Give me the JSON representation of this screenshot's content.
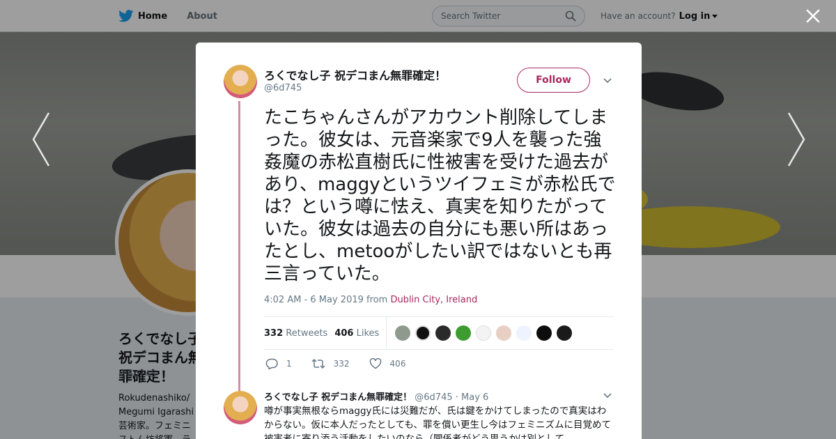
{
  "nav": {
    "home": "Home",
    "about": "About",
    "search_placeholder": "Search Twitter",
    "have_account": "Have an account?",
    "login": "Log in"
  },
  "profile": {
    "name": "ろくでなし子 祝デコまん無罪確定！",
    "handle": "@6d745",
    "bio": "Rokudenashiko/ Megumi Igarashi 芸術家。フェミニストん坊将軍。ラ=ぼおまゝこーなぜだぁ"
  },
  "tweet": {
    "author_name": "ろくでなし子 祝デコまん無罪確定！",
    "author_handle": "@6d745",
    "follow_label": "Follow",
    "text": "たこちゃんさんがアカウント削除してしまった。彼女は、元音楽家で9人を襲った強姦魔の赤松直樹氏に性被害を受けた過去があり、maggyというツイフェミが赤松氏では？という噂に怯え、真実を知りたがっていた。彼女は過去の自分にも悪い所はあったとし、metooがしたい訳ではないとも再三言っていた。",
    "timestamp": "4:02 AM - 6 May 2019",
    "from_label": "from",
    "location": "Dublin City, Ireland",
    "retweets_count": "332",
    "retweets_label": "Retweets",
    "likes_count": "406",
    "likes_label": "Likes",
    "reply_count": "1",
    "retweet_action_count": "332",
    "like_action_count": "406"
  },
  "reply": {
    "author_name": "ろくでなし子 祝デコまん無罪確定！",
    "author_handle": "@6d745",
    "date": "May 6",
    "text": "噂が事実無根ならmaggy氏には災難だが、氏は鍵をかけてしまったので真実はわからない。仮に本人だったとしても、罪を償い更生し今はフェミニズムに目覚めて被害者に寄り添う活動をしたいのなら（関係者がどう思うかは別として"
  },
  "colors": {
    "accent": "#a9275c",
    "twitter_blue": "#1da1f2",
    "thread_line": "#d48ca5"
  },
  "icons": [
    "twitter-bird-icon",
    "search-icon",
    "close-icon",
    "chevron-left-icon",
    "chevron-right-icon",
    "chevron-down-icon",
    "reply-icon",
    "retweet-icon",
    "heart-icon"
  ]
}
